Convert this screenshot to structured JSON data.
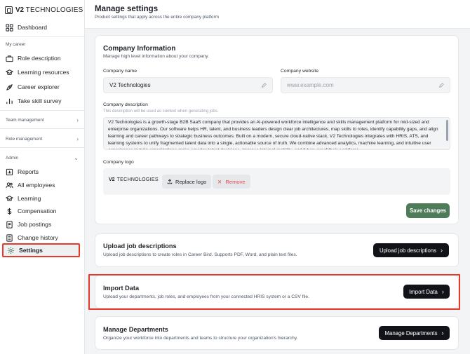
{
  "brand": {
    "strong": "V2",
    "rest": " TECHNOLOGIES"
  },
  "sidebar": {
    "dashboard": "Dashboard",
    "my_career_section": "My career",
    "my_career": [
      "Role description",
      "Learning resources",
      "Career explorer",
      "Take skill survey"
    ],
    "team_management": "Team management",
    "role_management": "Role management",
    "admin_section": "Admin",
    "admin": [
      "Reports",
      "All employees",
      "Learning",
      "Compensation",
      "Job postings",
      "Change history",
      "Settings"
    ],
    "active_item": "Settings"
  },
  "header": {
    "title": "Manage settings",
    "subtitle": "Product settings that apply across the entire company platform"
  },
  "company_info": {
    "title": "Company Information",
    "description": "Manage high level information about your company.",
    "name_label": "Company name",
    "name_value": "V2 Technologies",
    "website_label": "Company website",
    "website_placeholder": "www.example.com",
    "desc_label": "Company description",
    "desc_hint": "This description will be used as context when generating jobs.",
    "desc_value": "V2 Technologies is a growth-stage B2B SaaS company that provides an AI-powered workforce intelligence and skills management platform for mid-sized and enterprise organizations. Our software helps HR, talent, and business leaders design clear job architectures, map skills to roles, identify capability gaps, and align learning and career pathways to strategic business outcomes. Built on a modern, secure cloud-native stack, V2 Technologies integrates with HRIS, ATS, and learning systems to unify fragmented talent data into a single, actionable source of truth. We combine advanced analytics, machine learning, and intuitive user experiences to help organizations make smarter talent decisions, improve internal mobility, and future-proof their workforce.",
    "logo_label": "Company logo",
    "logo_strong": "V2",
    "logo_rest": " TECHNOLOGIES",
    "replace_logo": "Replace logo",
    "remove": "Remove",
    "save": "Save changes"
  },
  "upload_jobs": {
    "title": "Upload job descriptions",
    "description": "Upload job descriptions to create roles in Career Bird. Supports PDF, Word, and plain text files.",
    "button": "Upload job descriptions"
  },
  "import_data": {
    "title": "Import Data",
    "description": "Upload your departments, job roles, and employees from your connected HRIS system or a CSV file.",
    "button": "Import Data"
  },
  "departments": {
    "title": "Manage Departments",
    "description": "Organize your workforce into departments and teams to structure your organization's hierarchy.",
    "button": "Manage Departments"
  },
  "colors": {
    "highlight": "#e53a2a",
    "save_green": "#4e7c59",
    "dark_button": "#111318"
  }
}
